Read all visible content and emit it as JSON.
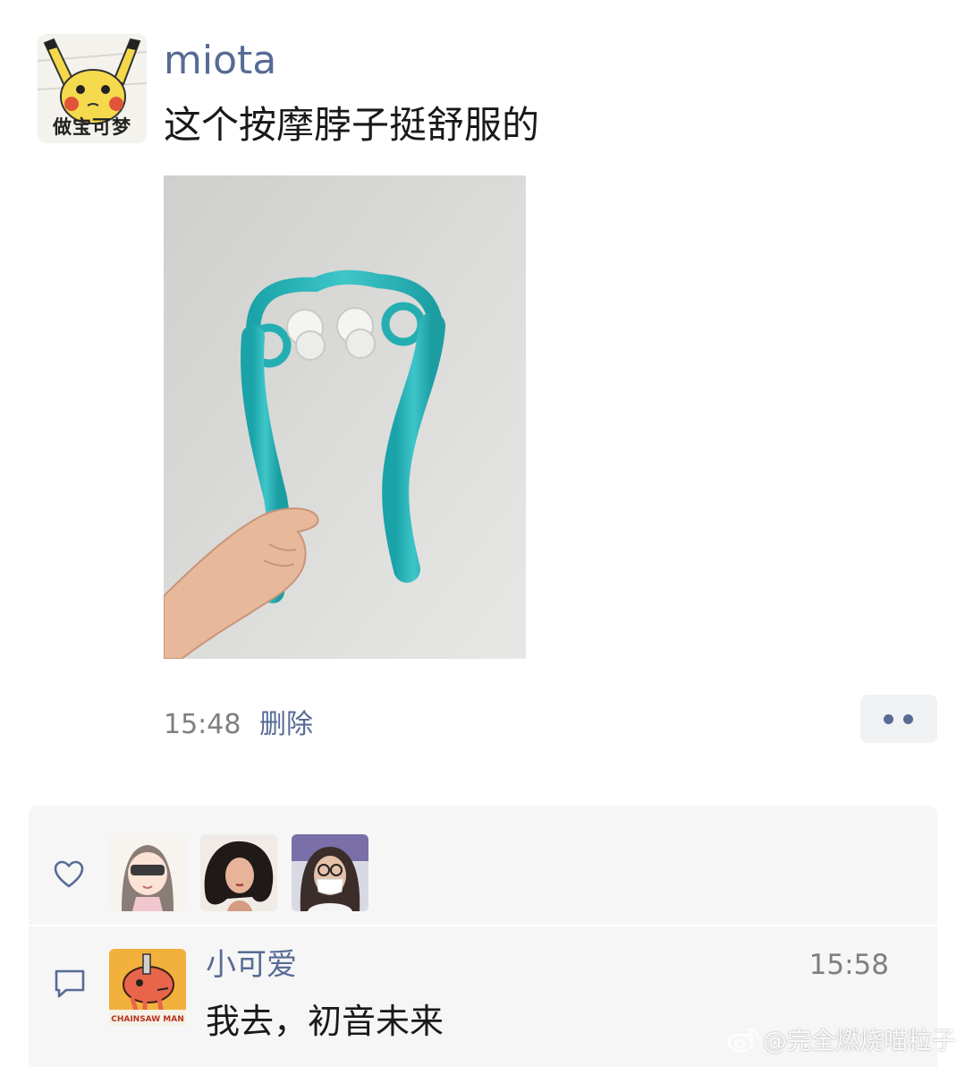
{
  "post": {
    "author": "miota",
    "avatar_caption": "做宝可梦",
    "text": "这个按摩脖子挺舒服的",
    "time": "15:48",
    "delete_label": "删除"
  },
  "likes": {
    "icon": "heart-icon",
    "count_avatars": 3
  },
  "comments": [
    {
      "author": "小可爱",
      "time": "15:58",
      "text": "我去，初音未来",
      "avatar_caption": "CHAINSAW MAN"
    }
  ],
  "watermark": {
    "text": "@完全燃烧喵粒子",
    "icon": "weibo-icon"
  },
  "colors": {
    "link": "#576b95",
    "text": "#191919",
    "muted": "#7f7f7f",
    "panel": "#f6f6f6"
  }
}
